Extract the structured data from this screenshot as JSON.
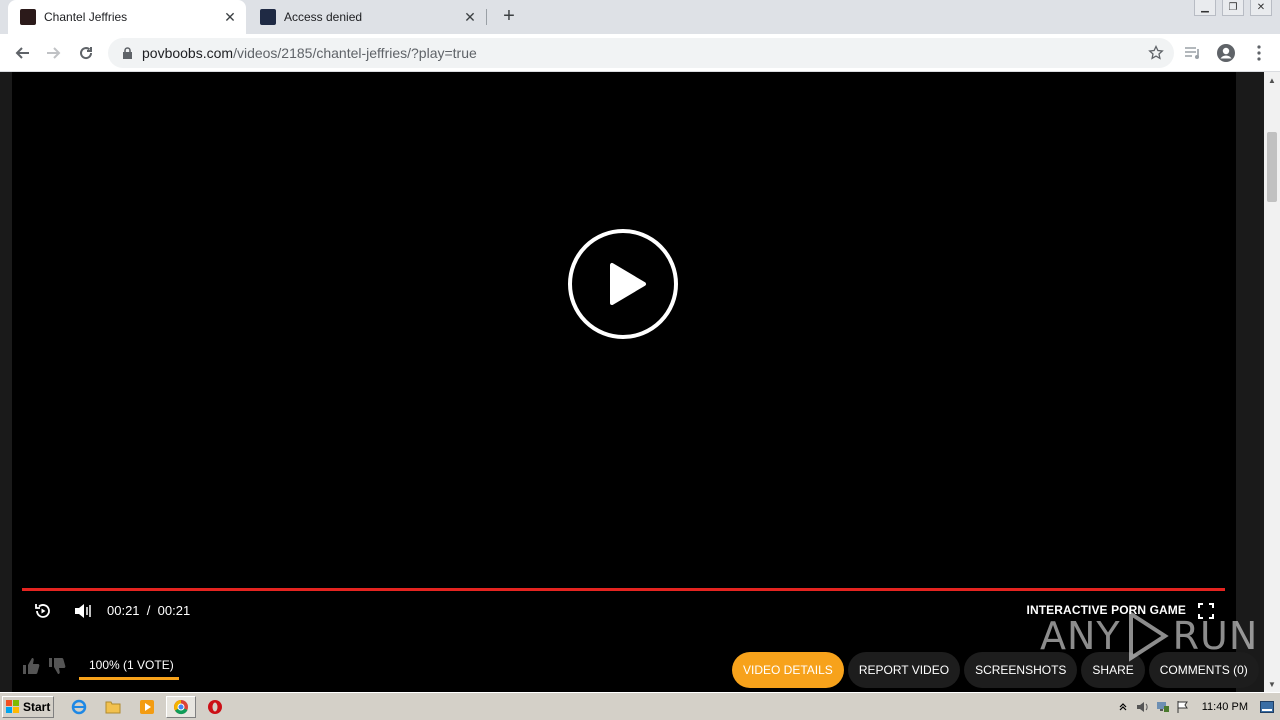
{
  "browser": {
    "tabs": [
      {
        "title": "Chantel Jeffries",
        "active": true
      },
      {
        "title": "Access denied",
        "active": false
      }
    ],
    "url": {
      "host": "povboobs.com",
      "path": "/videos/2185/chantel-jeffries/?play=true"
    }
  },
  "player": {
    "current_time": "00:21",
    "separator": "/",
    "duration": "00:21",
    "progress": 1.0,
    "interactive_game_label": "INTERACTIVE PORN GAME"
  },
  "rating": {
    "label": "100% (1 VOTE)",
    "percent": 100
  },
  "actions": {
    "tabs": [
      "VIDEO DETAILS",
      "REPORT VIDEO",
      "SCREENSHOTS",
      "SHARE",
      "COMMENTS (0)"
    ],
    "active": "VIDEO DETAILS"
  },
  "watermark": {
    "left": "ANY",
    "right": "RUN"
  },
  "taskbar": {
    "start_label": "Start",
    "clock": "11:40 PM"
  },
  "colors": {
    "progress": "#e52420",
    "accent": "#f7a21b"
  }
}
